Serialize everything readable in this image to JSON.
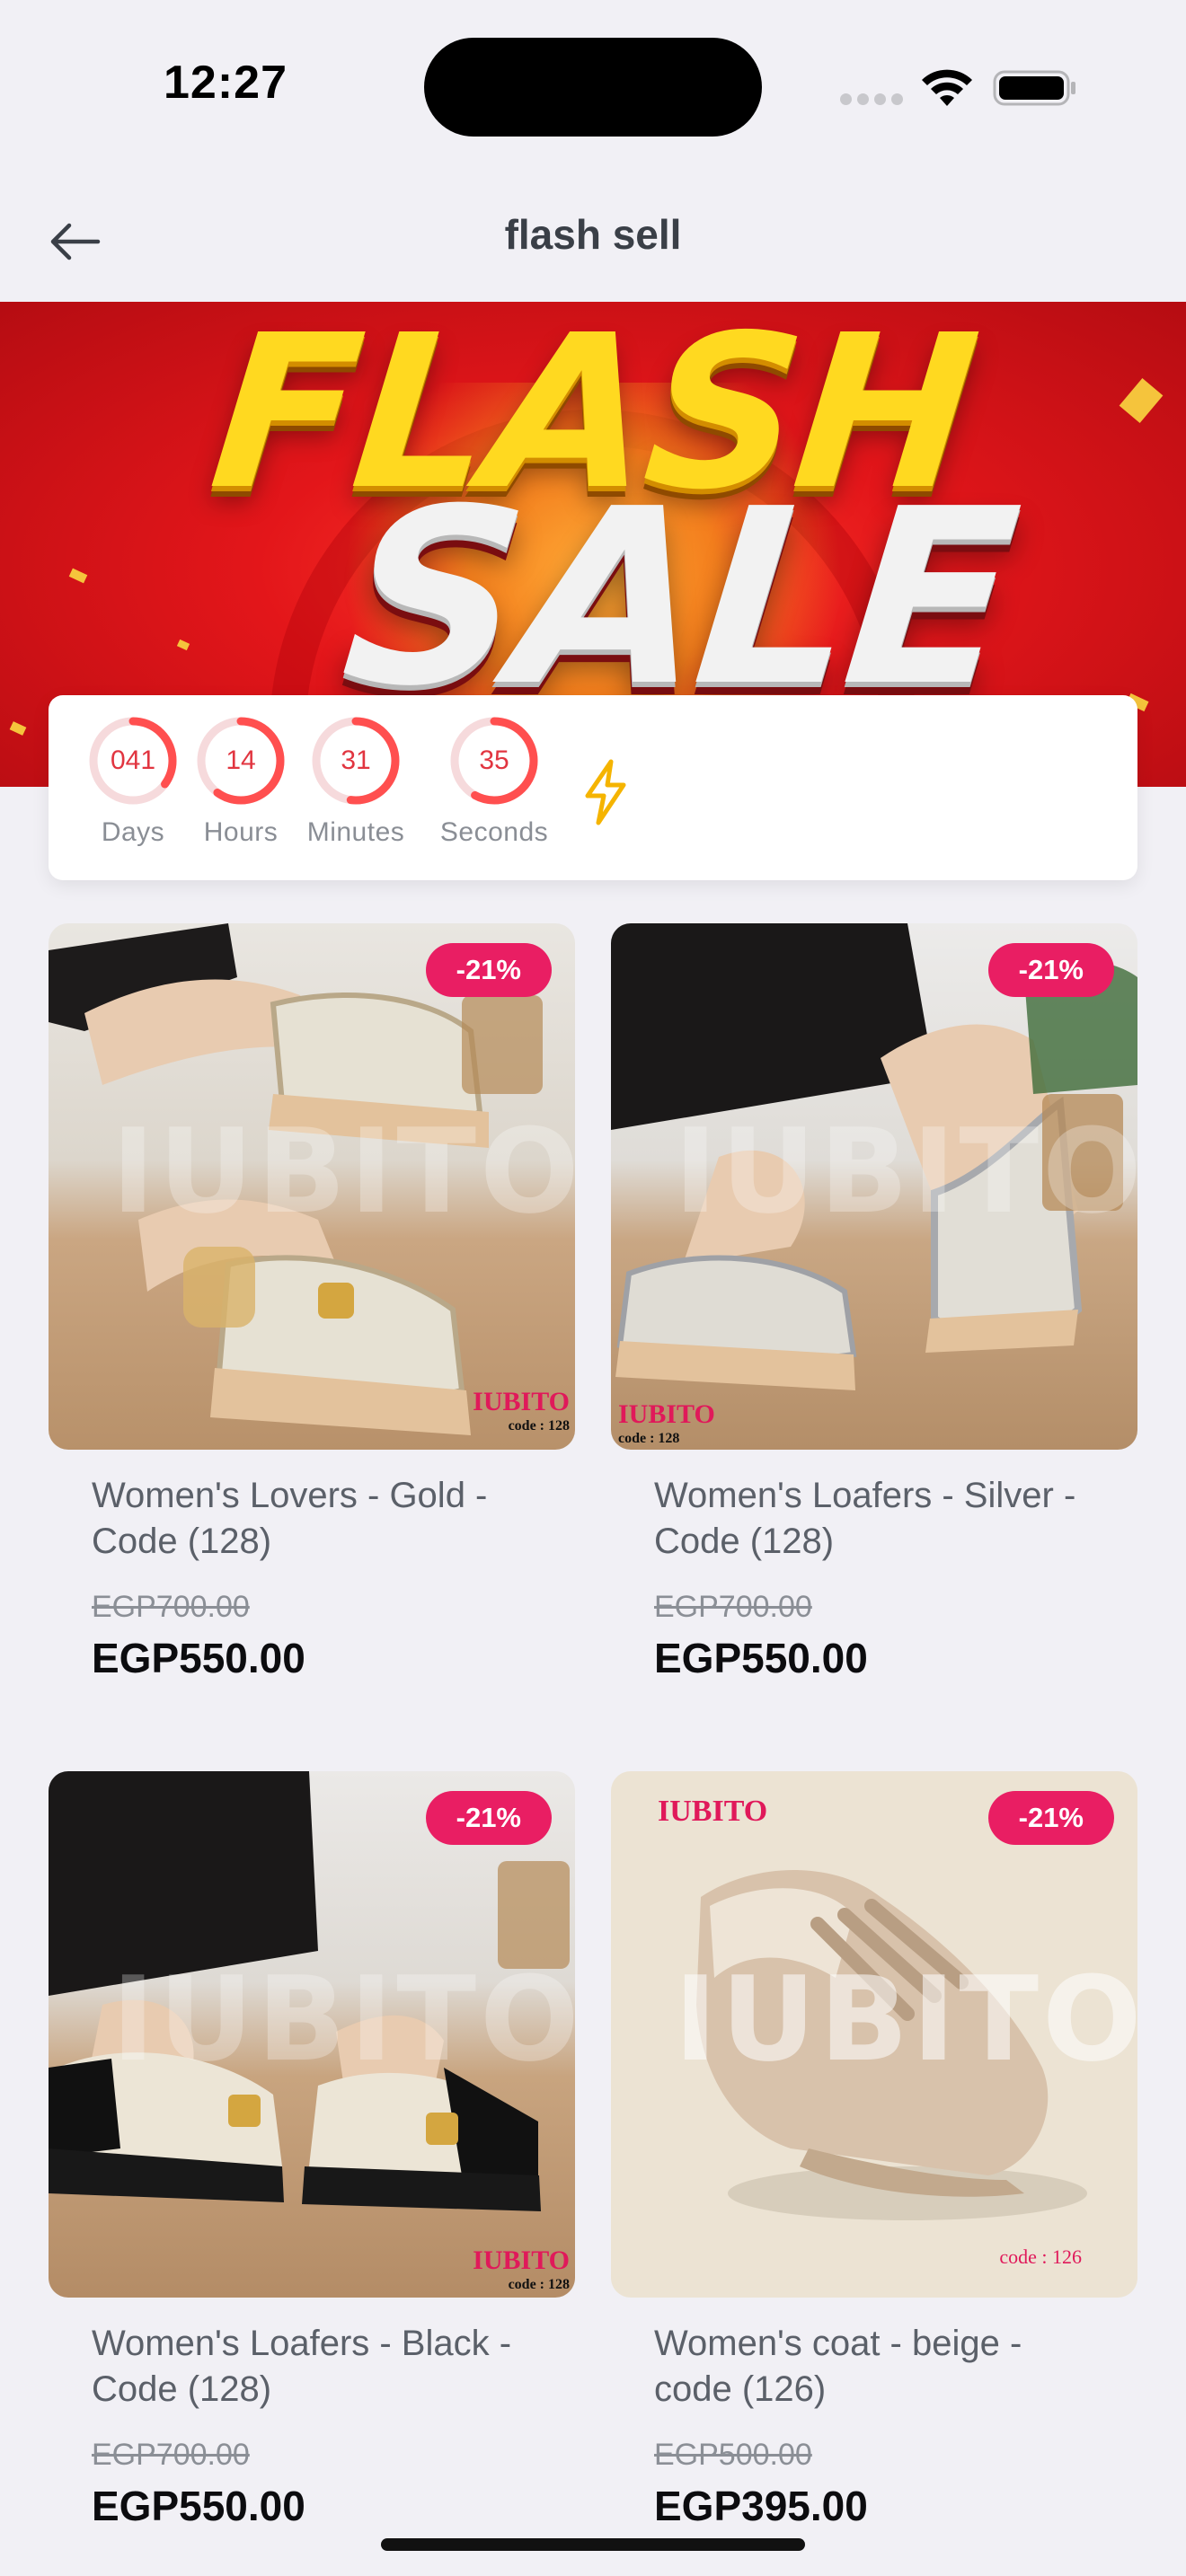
{
  "status": {
    "time": "12:27"
  },
  "nav": {
    "title": "flash sell"
  },
  "banner": {
    "line1": "FLASH",
    "line2": "SALE"
  },
  "countdown": [
    {
      "value": "041",
      "label": "Days",
      "progress": 0.35
    },
    {
      "value": "14",
      "label": "Hours",
      "progress": 0.6
    },
    {
      "value": "31",
      "label": "Minutes",
      "progress": 0.52
    },
    {
      "value": "35",
      "label": "Seconds",
      "progress": 0.58
    }
  ],
  "products": [
    {
      "name": "Women's Lovers - Gold - Code (128)",
      "old_price": "EGP700.00",
      "new_price": "EGP550.00",
      "discount": "-21%",
      "brand": "IUBITO",
      "brand_sub": "code : 128"
    },
    {
      "name": "Women's Loafers - Silver - Code (128)",
      "old_price": "EGP700.00",
      "new_price": "EGP550.00",
      "discount": "-21%",
      "brand": "IUBITO",
      "brand_sub": "code : 128"
    },
    {
      "name": "Women's Loafers - Black - Code (128)",
      "old_price": "EGP700.00",
      "new_price": "EGP550.00",
      "discount": "-21%",
      "brand": "IUBITO",
      "brand_sub": "code : 128"
    },
    {
      "name": "Women's coat - beige - code (126)",
      "old_price": "EGP500.00",
      "new_price": "EGP395.00",
      "discount": "-21%",
      "brand": "IUBITO",
      "brand_sub": "code : 126"
    }
  ],
  "colors": {
    "accent": "#e91e63",
    "timer": "#ff4f4f",
    "banner": "#e3161a",
    "bolt": "#f5b400"
  }
}
